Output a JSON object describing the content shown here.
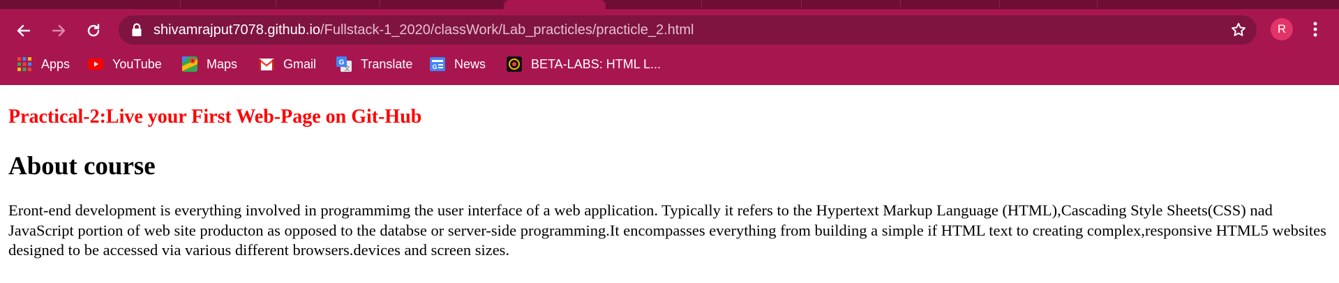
{
  "browser": {
    "url_host": "shivamrajput7078.github.io",
    "url_path": "/Fullstack-1_2020/classWork/Lab_practicles/practicle_2.html",
    "profile_initial": "R",
    "accent_color": "#a8164f"
  },
  "bookmarks": [
    {
      "label": "Apps",
      "icon": "apps-grid-icon"
    },
    {
      "label": "YouTube",
      "icon": "youtube-icon"
    },
    {
      "label": "Maps",
      "icon": "maps-icon"
    },
    {
      "label": "Gmail",
      "icon": "gmail-icon"
    },
    {
      "label": "Translate",
      "icon": "translate-icon"
    },
    {
      "label": "News",
      "icon": "news-icon"
    },
    {
      "label": "BETA-LABS: HTML L...",
      "icon": "beta-labs-icon"
    }
  ],
  "page": {
    "heading": "Practical-2:Live your First Web-Page on Git-Hub",
    "subheading": "About course",
    "paragraph": "Eront-end development is everything involved in programmimg the user interface of a web application. Typically it refers to the Hypertext Markup Language (HTML),Cascading Style Sheets(CSS) nad JavaScript portion of web site producton as opposed to the databse or server-side programming.It encompasses everything from building a simple if HTML text to creating complex,responsive HTML5 websites designed to be accessed via various different browsers.devices and screen sizes."
  }
}
